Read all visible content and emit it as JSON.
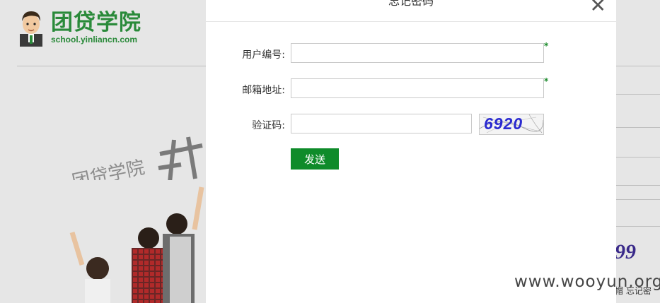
{
  "background": {
    "logo_title": "团贷学院",
    "logo_url": "school.yinliancn.com",
    "banner_text": "团贷学院",
    "right_captcha_fragment": "99",
    "right_links_fragment": "帽  忘记密"
  },
  "modal": {
    "title": "忘记密码",
    "close_glyph": "✕",
    "fields": {
      "user_id": {
        "label": "用户编号:",
        "value": "",
        "required_mark": "*"
      },
      "email": {
        "label": "邮箱地址:",
        "value": "",
        "required_mark": "*"
      },
      "captcha": {
        "label": "验证码:",
        "value": "",
        "image_text": "6920"
      }
    },
    "send_label": "发送"
  },
  "watermark": "www.wooyun.org",
  "colors": {
    "brand_green": "#0f8b2a",
    "logo_green": "#2a8a3a",
    "captcha_blue": "#2a2ad0"
  }
}
